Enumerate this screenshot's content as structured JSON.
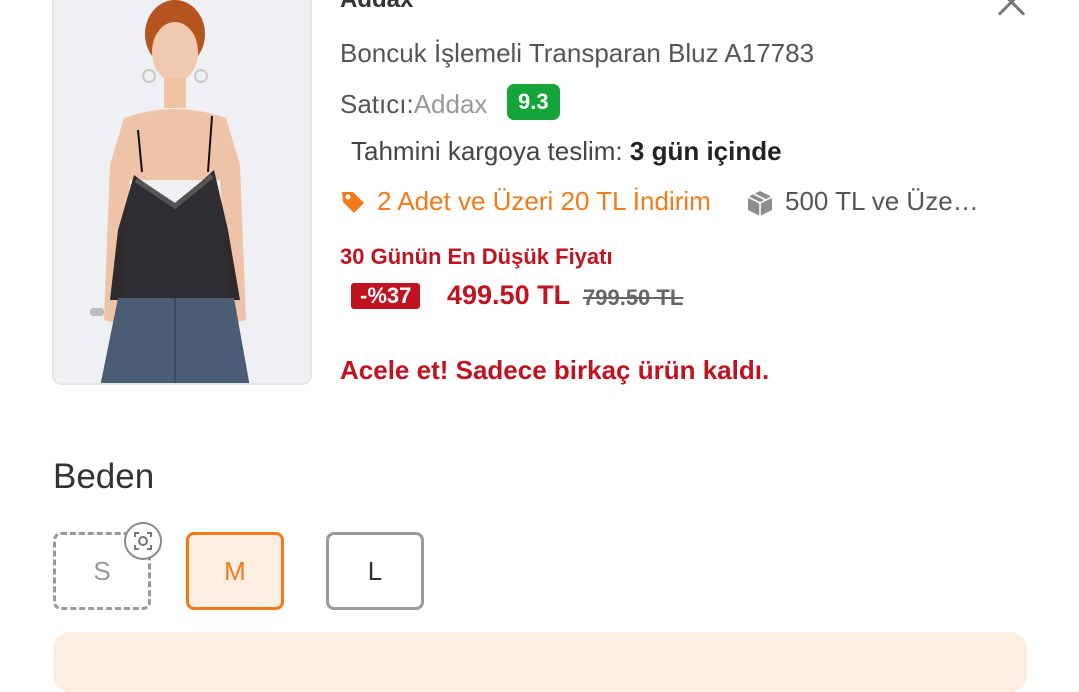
{
  "product": {
    "brand": "Addax",
    "title": "Boncuk İşlemeli Transparan Bluz A17783",
    "seller_label": "Satıcı:",
    "seller_name": "Addax",
    "seller_score": "9.3",
    "delivery_label": "Tahmini kargoya teslim: ",
    "delivery_value": "3 gün içinde",
    "promo_discount": "2 Adet ve Üzeri 20 TL İndirim",
    "promo_shipping": "500 TL ve Üze…",
    "lowest_price_label": "30 Günün En Düşük Fiyatı",
    "discount_badge": "-%37",
    "price": "499.50 TL",
    "old_price": "799.50 TL",
    "stock_warning": "Acele et! Sadece birkaç ürün kaldı."
  },
  "size_section": {
    "heading": "Beden",
    "sizes": [
      {
        "label": "S",
        "state": "unavailable"
      },
      {
        "label": "M",
        "state": "selected"
      },
      {
        "label": "L",
        "state": "available"
      }
    ]
  },
  "colors": {
    "accent": "#f27a1a",
    "sale_red": "#c1121f",
    "score_green": "#13a538"
  },
  "icons": {
    "close": "close-icon",
    "tag": "tag-icon",
    "box": "box-icon",
    "camera": "camera-scan-icon"
  }
}
